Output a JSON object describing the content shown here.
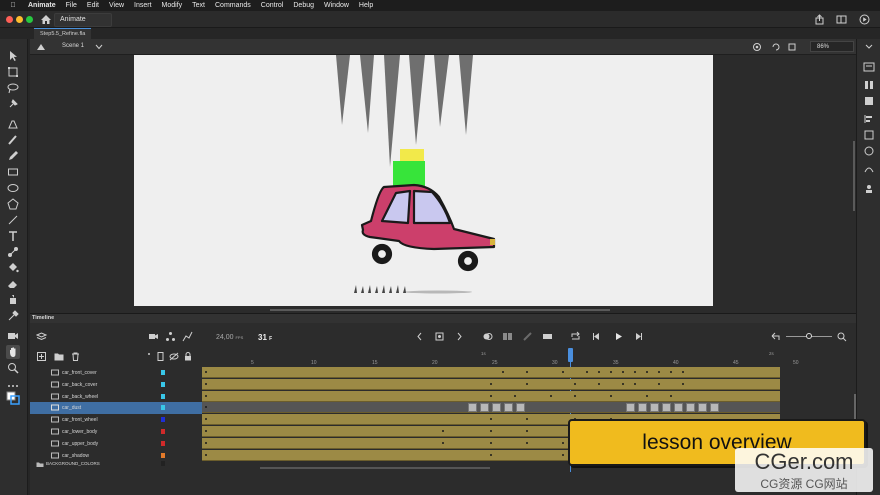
{
  "menubar": {
    "app_name": "Animate",
    "items": [
      "File",
      "Edit",
      "View",
      "Insert",
      "Modify",
      "Text",
      "Commands",
      "Control",
      "Debug",
      "Window",
      "Help"
    ]
  },
  "titlebar": {
    "tab_label": "Animate"
  },
  "document": {
    "tab_label": "Step5.5_Refine.fla"
  },
  "scene": {
    "label": "Scene 1",
    "zoom": "86%"
  },
  "timeline": {
    "panel_title": "Timeline",
    "fps_value": "24,00",
    "fps_unit": "FPS",
    "current_frame": "31",
    "frame_suffix": "F",
    "ruler_labels": [
      "5",
      "10",
      "15",
      "20",
      "25",
      "30",
      "35",
      "40",
      "45",
      "50"
    ],
    "second_labels": [
      "1s",
      "2s"
    ],
    "layers": [
      {
        "name": "car_front_cover",
        "color": "#39c7e8",
        "selected": false
      },
      {
        "name": "car_back_cover",
        "color": "#39c7e8",
        "selected": false
      },
      {
        "name": "car_back_wheel",
        "color": "#39c7e8",
        "selected": false
      },
      {
        "name": "car_dust",
        "color": "#39c7e8",
        "selected": true
      },
      {
        "name": "car_front_wheel",
        "color": "#1f2fd6",
        "selected": false
      },
      {
        "name": "car_lower_body",
        "color": "#d02a2a",
        "selected": false
      },
      {
        "name": "car_upper_body",
        "color": "#d02a2a",
        "selected": false
      },
      {
        "name": "car_shadow",
        "color": "#e27a2a",
        "selected": false
      },
      {
        "name": "BACKGROUND_COLORS",
        "color": "#222222",
        "selected": false
      }
    ]
  },
  "overlay": {
    "lesson_text": "lesson overview",
    "watermark_main": "CGer.com",
    "watermark_sub": "CG资源 CG网站"
  },
  "colors": {
    "car_body": "#cc3f6b",
    "car_window": "#c9c8ef",
    "box_green": "#37e43a",
    "box_yellow": "#f2e94a",
    "spike_gray": "#6f6f6f",
    "frame_gold": "#9c8a45",
    "banner": "#f0bb1e"
  }
}
